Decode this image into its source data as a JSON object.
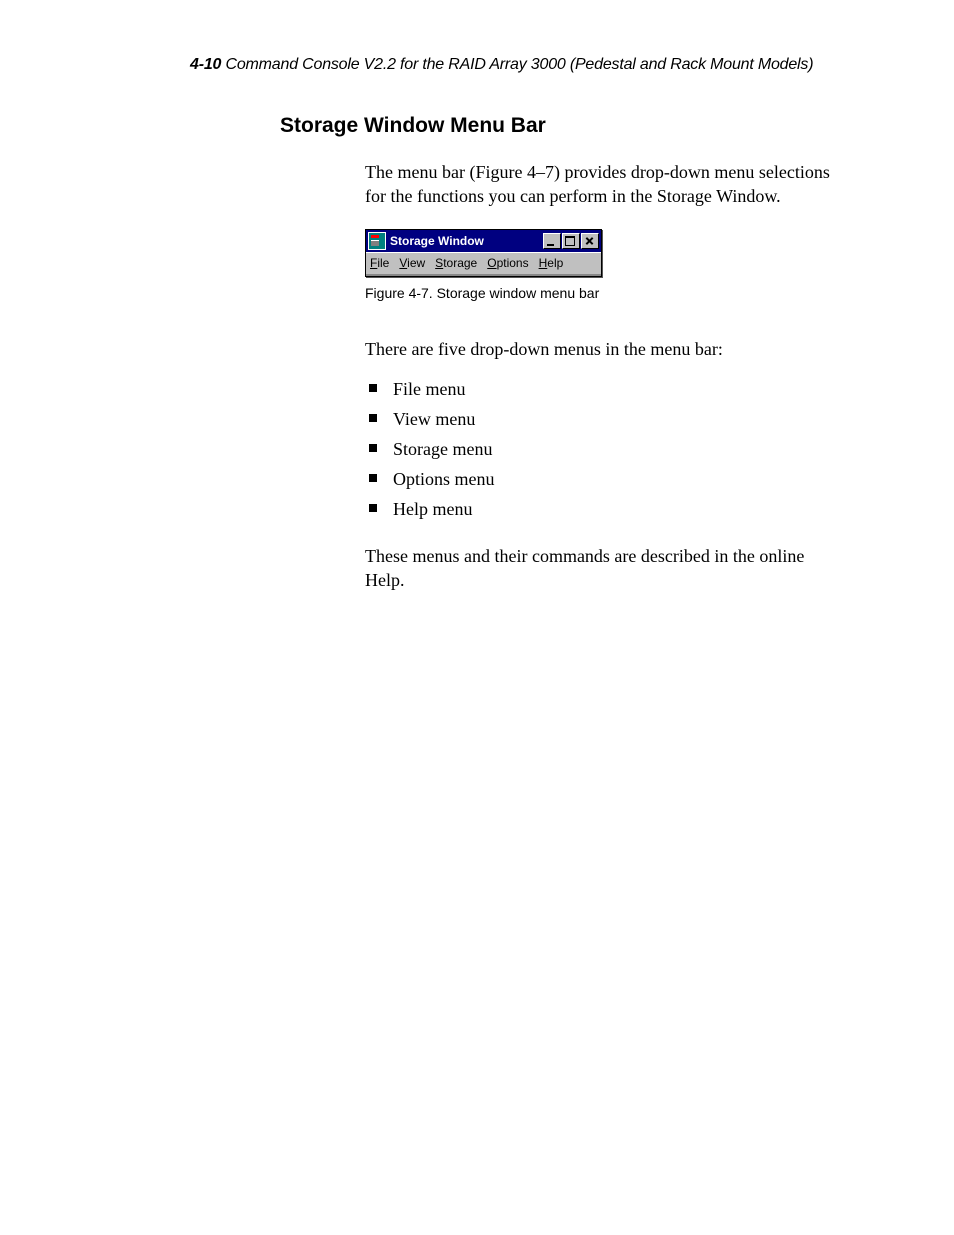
{
  "header": {
    "page_number": "4-10",
    "title": "Command Console V2.2 for the RAID Array 3000 (Pedestal and Rack Mount Models)"
  },
  "section_heading": "Storage Window Menu Bar",
  "intro_para": "The menu bar (Figure 4–7) provides drop-down menu selections for the functions you can perform in the Storage Window.",
  "figure": {
    "window_title": "Storage Window",
    "menus": [
      {
        "mnemonic": "F",
        "rest": "ile"
      },
      {
        "mnemonic": "V",
        "rest": "iew"
      },
      {
        "mnemonic": "S",
        "rest": "torage"
      },
      {
        "mnemonic": "O",
        "rest": "ptions"
      },
      {
        "mnemonic": "H",
        "rest": "elp"
      }
    ],
    "caption": "Figure 4-7.  Storage window menu bar"
  },
  "list_intro": "There are five drop-down menus in the menu bar:",
  "menu_list": [
    "File menu",
    "View menu",
    "Storage menu",
    "Options menu",
    "Help menu"
  ],
  "closing_para": "These menus and their commands are described in the online Help."
}
